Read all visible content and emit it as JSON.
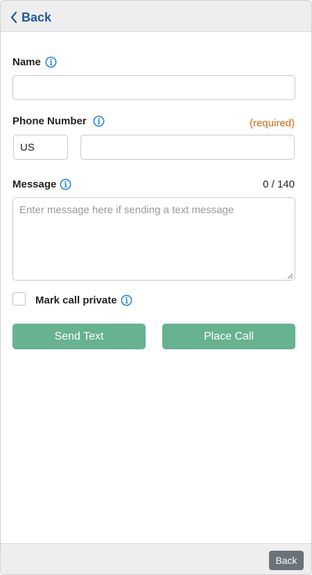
{
  "header": {
    "back_label": "Back"
  },
  "form": {
    "name_label": "Name",
    "name_value": "",
    "phone_label": "Phone Number",
    "phone_required": "(required)",
    "country_code": "US",
    "phone_value": "",
    "message_label": "Message",
    "message_counter": "0 / 140",
    "message_placeholder": "Enter message here if sending a text message",
    "private_label": "Mark call private",
    "private_checked": false
  },
  "actions": {
    "send_text": "Send Text",
    "place_call": "Place Call"
  },
  "footer": {
    "back_label": "Back"
  },
  "colors": {
    "accent_blue": "#1f5a96",
    "info_icon_blue": "#1a7ee0",
    "required_orange": "#d06a16",
    "button_green": "#66b291",
    "footer_button": "#6b7378"
  },
  "icons": [
    "chevron-left-icon",
    "info-icon",
    "resize-grip-icon"
  ]
}
